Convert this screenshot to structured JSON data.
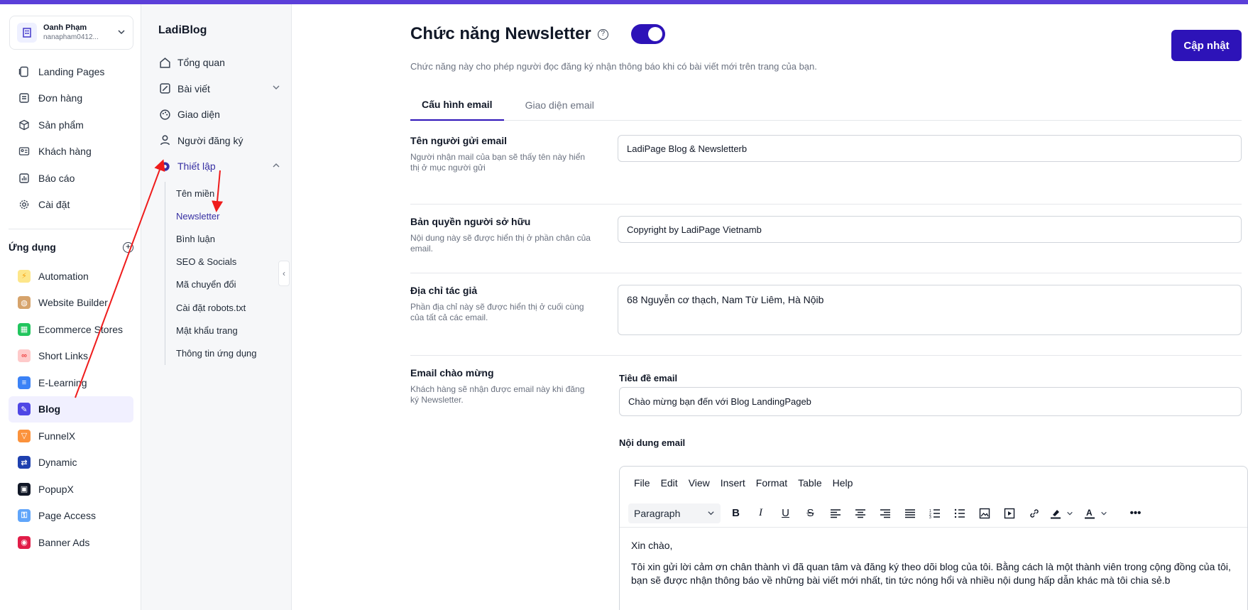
{
  "account": {
    "name": "Oanh Phạm",
    "email": "nanapham0412..."
  },
  "nav": [
    {
      "label": "Landing Pages",
      "icon": "layers-icon"
    },
    {
      "label": "Đơn hàng",
      "icon": "order-icon"
    },
    {
      "label": "Sản phẩm",
      "icon": "box-icon"
    },
    {
      "label": "Khách hàng",
      "icon": "contact-card-icon"
    },
    {
      "label": "Báo cáo",
      "icon": "report-icon"
    },
    {
      "label": "Cài đặt",
      "icon": "gear-icon"
    }
  ],
  "apps": {
    "heading": "Ứng dụng",
    "items": [
      {
        "label": "Automation",
        "color": "#f59e0b"
      },
      {
        "label": "Website Builder",
        "color": "#a16207"
      },
      {
        "label": "Ecommerce Stores",
        "color": "#16a34a"
      },
      {
        "label": "Short Links",
        "color": "#ef4444"
      },
      {
        "label": "E-Learning",
        "color": "#2563eb"
      },
      {
        "label": "Blog",
        "color": "#4f46e5"
      },
      {
        "label": "FunnelX",
        "color": "#f97316"
      },
      {
        "label": "Dynamic",
        "color": "#1e40af"
      },
      {
        "label": "PopupX",
        "color": "#111827"
      },
      {
        "label": "Page Access",
        "color": "#3b82f6"
      },
      {
        "label": "Banner Ads",
        "color": "#e11d48"
      }
    ]
  },
  "blog_nav": {
    "brand": "LadiBlog",
    "items": [
      {
        "label": "Tổng quan",
        "icon": "home-icon"
      },
      {
        "label": "Bài viết",
        "icon": "edit-icon"
      },
      {
        "label": "Giao diện",
        "icon": "palette-icon"
      },
      {
        "label": "Người đăng ký",
        "icon": "user-icon"
      },
      {
        "label": "Thiết lập",
        "icon": "gear-icon"
      }
    ],
    "sub_items": [
      "Tên miền",
      "Newsletter",
      "Bình luận",
      "SEO & Socials",
      "Mã chuyển đổi",
      "Cài đặt robots.txt",
      "Mật khẩu trang",
      "Thông tin ứng dụng"
    ]
  },
  "page": {
    "title": "Chức năng Newsletter",
    "subtitle": "Chức năng này cho phép người đọc đăng ký nhận thông báo khi có bài viết mới trên trang của bạn.",
    "update_button": "Cập nhật",
    "toggle_on": true,
    "tabs": [
      "Cấu hình email",
      "Giao diện email"
    ]
  },
  "form": {
    "sender": {
      "title": "Tên người gửi email",
      "desc": "Người nhận mail của bạn sẽ thấy tên này hiển thị ở mục người gửi",
      "value": "LadiPage Blog & Newsletterb"
    },
    "copyright": {
      "title": "Bản quyền người sở hữu",
      "desc": "Nội dung này sẽ được hiển thị ở phần chân của email.",
      "value": "Copyright by LadiPage Vietnamb"
    },
    "address": {
      "title": "Địa chỉ tác giả",
      "desc": "Phần địa chỉ này sẽ được hiển thị ở cuối cùng của tất cả các email.",
      "value": "68 Nguyễn cơ thạch, Nam Từ Liêm, Hà Nộib"
    },
    "welcome": {
      "title": "Email chào mừng",
      "desc": "Khách hàng sẽ nhận được email này khi đăng ký Newsletter.",
      "subject_label": "Tiêu đề email",
      "subject_value": "Chào mừng bạn đến với Blog LandingPageb",
      "content_label": "Nội dung email"
    }
  },
  "editor": {
    "menus": [
      "File",
      "Edit",
      "View",
      "Insert",
      "Format",
      "Table",
      "Help"
    ],
    "block_format": "Paragraph",
    "line1": "Xin chào,",
    "line2": "Tôi xin gửi lời cảm ơn chân thành vì đã quan tâm và đăng ký theo dõi blog của tôi. Bằng cách là một thành viên trong cộng đồng của tôi, bạn sẽ được nhận thông báo về những bài viết mới nhất, tin tức nóng hổi và nhiều nội dung hấp dẫn khác mà tôi chia sẻ.b"
  },
  "colors": {
    "accent": "#2d13b8",
    "annotation_arrow": "#ef1c1c"
  }
}
